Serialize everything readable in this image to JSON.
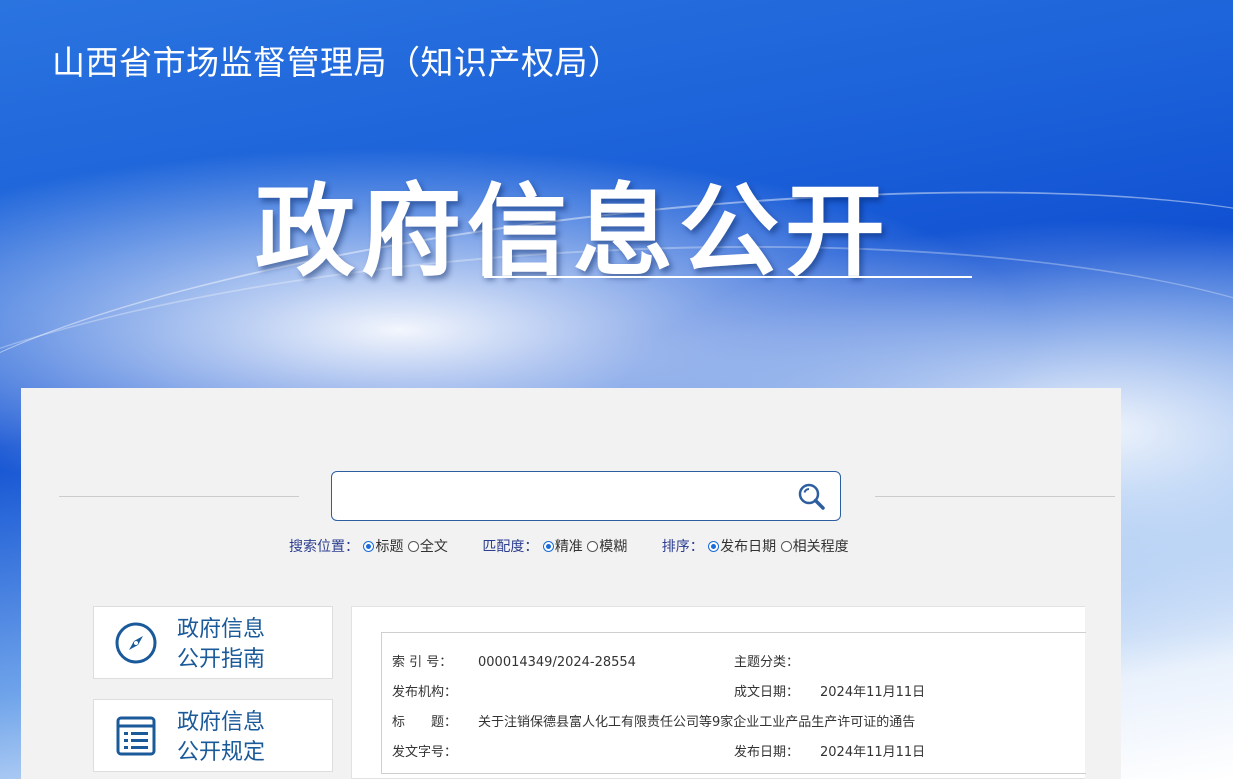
{
  "header": {
    "org_title": "山西省市场监督管理局（知识产权局）",
    "hero_title": "政府信息公开"
  },
  "search": {
    "placeholder": "",
    "options": [
      {
        "label": "搜索位置：",
        "choices": [
          {
            "text": "标题",
            "selected": true
          },
          {
            "text": "全文",
            "selected": false
          }
        ]
      },
      {
        "label": "匹配度：",
        "choices": [
          {
            "text": "精准",
            "selected": true
          },
          {
            "text": "模糊",
            "selected": false
          }
        ]
      },
      {
        "label": "排序：",
        "choices": [
          {
            "text": "发布日期",
            "selected": true
          },
          {
            "text": "相关程度",
            "selected": false
          }
        ]
      }
    ]
  },
  "sidebar": {
    "items": [
      {
        "line1": "政府信息",
        "line2": "公开指南",
        "icon": "compass-icon"
      },
      {
        "line1": "政府信息",
        "line2": "公开规定",
        "icon": "document-list-icon"
      }
    ]
  },
  "meta": {
    "index_label": "索 引 号：",
    "index_value": "000014349/2024-28554",
    "topic_label": "主题分类：",
    "topic_value": "",
    "publisher_label": "发布机构：",
    "publisher_value": "",
    "created_label": "成文日期：",
    "created_value": "2024年11月11日",
    "title_label": "标　　题：",
    "title_value": "关于注销保德县富人化工有限责任公司等9家企业工业产品生产许可证的通告",
    "docno_label": "发文字号：",
    "docno_value": "",
    "published_label": "发布日期：",
    "published_value": "2024年11月11日"
  },
  "colors": {
    "accent": "#1b5a9a",
    "banner_blue": "#1151d2"
  }
}
